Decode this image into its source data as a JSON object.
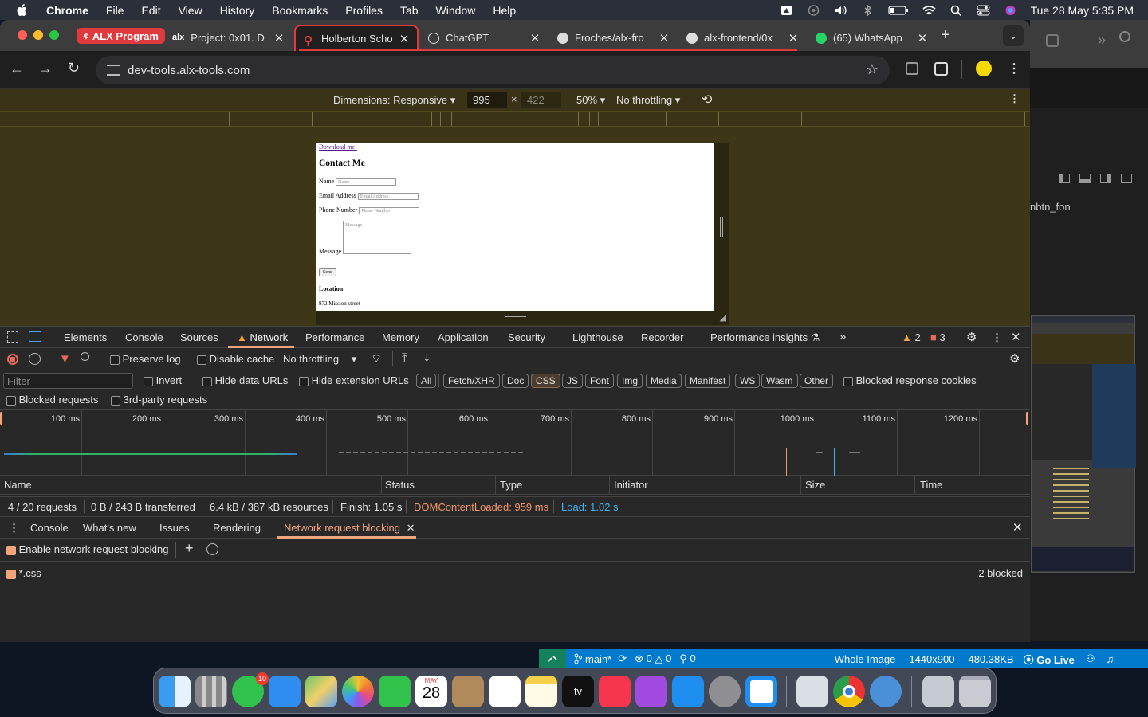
{
  "menubar": {
    "app": "Chrome",
    "items": [
      "File",
      "Edit",
      "View",
      "History",
      "Bookmarks",
      "Profiles",
      "Tab",
      "Window",
      "Help"
    ],
    "clock": "Tue 28 May  5:35 PM"
  },
  "browser": {
    "tab_group": "ALX Program",
    "tabs": [
      {
        "title": "Project: 0x01. D"
      },
      {
        "title": "Holberton Scho"
      },
      {
        "title": "ChatGPT"
      },
      {
        "title": "Froches/alx-fro"
      },
      {
        "title": "alx-frontend/0x"
      },
      {
        "title": "(65) WhatsApp"
      }
    ],
    "url": "dev-tools.alx-tools.com"
  },
  "device_toolbar": {
    "dimensions_label": "Dimensions: Responsive",
    "width": "995",
    "height_placeholder": "422",
    "zoom": "50%",
    "throttling": "No throttling"
  },
  "page": {
    "download_link": "Download me!",
    "heading": "Contact Me",
    "name_label": "Name",
    "name_placeholder": "Name",
    "email_label": "Email Address",
    "email_placeholder": "Email Address",
    "phone_label": "Phone Number",
    "phone_placeholder": "Phone Number",
    "message_label": "Message",
    "message_placeholder": "Message",
    "send": "Send",
    "location_heading": "Location",
    "address": "972 Mission street"
  },
  "devtools": {
    "tabs": [
      "Elements",
      "Console",
      "Sources",
      "Network",
      "Performance",
      "Memory",
      "Application",
      "Security",
      "Lighthouse",
      "Recorder",
      "Performance insights"
    ],
    "warnings": "2",
    "errors": "3",
    "preserve_log": "Preserve log",
    "disable_cache": "Disable cache",
    "throttling": "No throttling",
    "filter_placeholder": "Filter",
    "invert": "Invert",
    "hide_data_urls": "Hide data URLs",
    "hide_extension_urls": "Hide extension URLs",
    "type_filters": [
      "All",
      "Fetch/XHR",
      "Doc",
      "CSS",
      "JS",
      "Font",
      "Img",
      "Media",
      "Manifest",
      "WS",
      "Wasm",
      "Other"
    ],
    "active_type_filter": "CSS",
    "blocked_response_cookies": "Blocked response cookies",
    "blocked_requests": "Blocked requests",
    "third_party_requests": "3rd-party requests",
    "timeline_labels": [
      "100 ms",
      "200 ms",
      "300 ms",
      "400 ms",
      "500 ms",
      "600 ms",
      "700 ms",
      "800 ms",
      "900 ms",
      "1000 ms",
      "1100 ms",
      "1200 ms"
    ],
    "columns": [
      "Name",
      "Status",
      "Type",
      "Initiator",
      "Size",
      "Time"
    ],
    "summary": {
      "requests": "4 / 20 requests",
      "transferred": "0 B / 243 B transferred",
      "resources": "6.4 kB / 387 kB resources",
      "finish": "Finish: 1.05 s",
      "dom_content_loaded": "DOMContentLoaded: 959 ms",
      "load": "Load: 1.02 s"
    },
    "drawer_tabs": [
      "Console",
      "What's new",
      "Issues",
      "Rendering",
      "Network request blocking"
    ],
    "enable_blocking": "Enable network request blocking",
    "pattern": "*.css",
    "pattern_status": "2 blocked"
  },
  "vscode_status": {
    "branch": "main*",
    "errors": "0",
    "warnings": "0",
    "ports": "0",
    "image_mode": "Whole Image",
    "image_size": "1440x900",
    "file_size": "480.38KB",
    "go_live": "Go Live"
  },
  "dock": {
    "messages_badge": "10",
    "calendar_month": "MAY",
    "calendar_day": "28"
  },
  "colors": {
    "accent": "#e0393e",
    "devtools_bg": "#282828",
    "device_toolbar_bg": "#3a3317",
    "dcl_color": "#f29766",
    "load_color": "#3ab4f2",
    "vscode_blue": "#007acc"
  }
}
